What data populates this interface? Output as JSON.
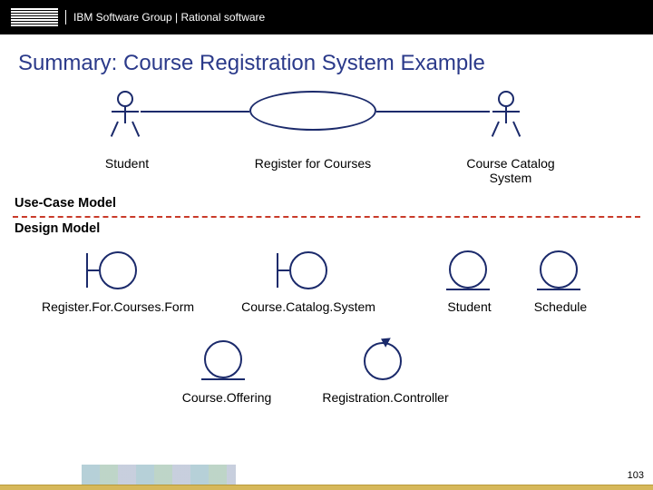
{
  "header": {
    "logo_text": "IBM",
    "breadcrumb": "IBM Software Group | Rational software"
  },
  "title": "Summary: Course Registration System Example",
  "sections": {
    "use_case_model": "Use-Case Model",
    "design_model": "Design Model"
  },
  "usecase_diagram": {
    "actor_left": "Student",
    "usecase": "Register for Courses",
    "actor_right": "Course Catalog\nSystem"
  },
  "design_elements": {
    "boundary1": "Register.For.Courses.Form",
    "boundary2": "Course.Catalog.System",
    "entity1": "Student",
    "entity2": "Schedule",
    "entity3": "Course.Offering",
    "control1": "Registration.Controller"
  },
  "slide_number": "103",
  "colors": {
    "title": "#2b3a8a",
    "uml_stroke": "#1b2a6b",
    "divider": "#c93b2a",
    "footer_stripe": "#d6b85a"
  }
}
